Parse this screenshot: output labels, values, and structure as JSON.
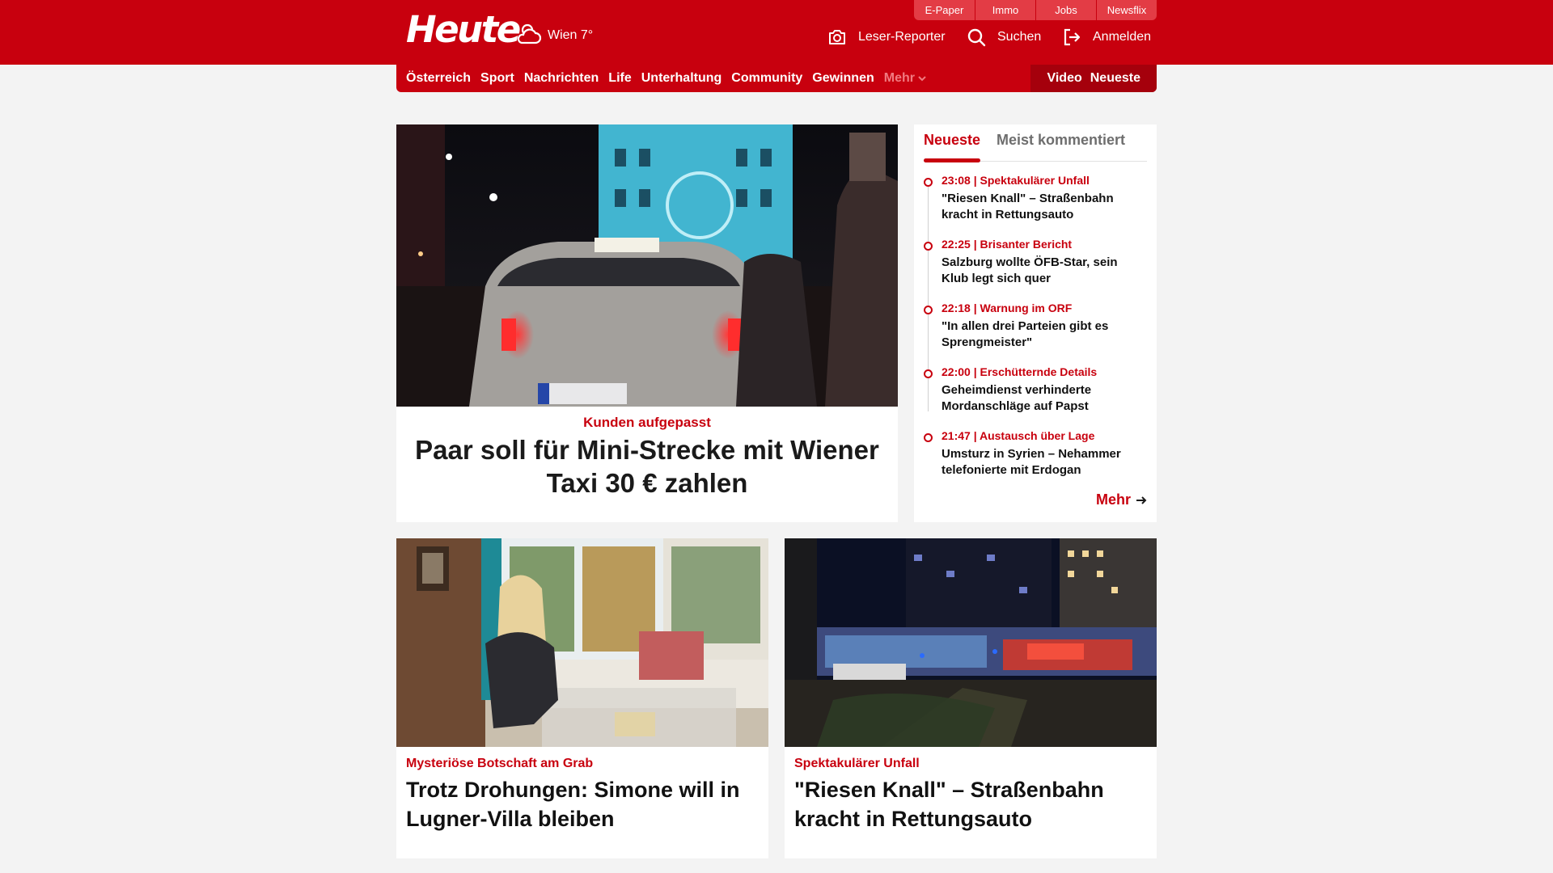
{
  "header": {
    "logo": "Heute",
    "weather": "Wien 7°",
    "service_links": [
      "E-Paper",
      "Immo",
      "Jobs",
      "Newsflix"
    ],
    "leser_reporter": "Leser-Reporter",
    "search": "Suchen",
    "login": "Anmelden"
  },
  "nav": {
    "items": [
      "Österreich",
      "Sport",
      "Nachrichten",
      "Life",
      "Unterhaltung",
      "Community",
      "Gewinnen"
    ],
    "more": "Mehr",
    "video": "Video",
    "latest": "Neueste"
  },
  "hero": {
    "kicker": "Kunden aufgepasst",
    "title": "Paar soll für Mini-Strecke mit Wiener Taxi 30 € zahlen"
  },
  "sidebar": {
    "tab_active": "Neueste",
    "tab_inactive": "Meist kommentiert",
    "items": [
      {
        "meta": "23:08 | Spektakulärer Unfall",
        "title": "\"Riesen Knall\" – Straßenbahn kracht in Rettungsauto"
      },
      {
        "meta": "22:25 | Brisanter Bericht",
        "title": "Salzburg wollte ÖFB-Star, sein Klub legt sich quer"
      },
      {
        "meta": "22:18 | Warnung im ORF",
        "title": "\"In allen drei Parteien gibt es Sprengmeister\""
      },
      {
        "meta": "22:00 | Erschütternde Details",
        "title": "Geheimdienst verhinderte Mordanschläge auf Papst"
      },
      {
        "meta": "21:47 | Austausch über Lage",
        "title": "Umsturz in Syrien – Nehammer telefonierte mit Erdogan"
      }
    ],
    "more": "Mehr"
  },
  "cards": [
    {
      "kicker": "Mysteriöse Botschaft am Grab",
      "title": "Trotz Drohungen: Simone will in Lugner-Villa bleiben"
    },
    {
      "kicker": "Spektakulärer Unfall",
      "title": "\"Riesen Knall\" – Straßenbahn kracht in Rettungsauto"
    }
  ],
  "icons": {
    "weather": "cloud-sun-icon",
    "camera": "camera-icon",
    "search": "search-icon",
    "login": "login-icon",
    "chevron": "chevron-down-icon",
    "arrow": "arrow-right-icon"
  },
  "colors": {
    "brand_red": "#c8000e",
    "background": "#f3f3f3"
  }
}
